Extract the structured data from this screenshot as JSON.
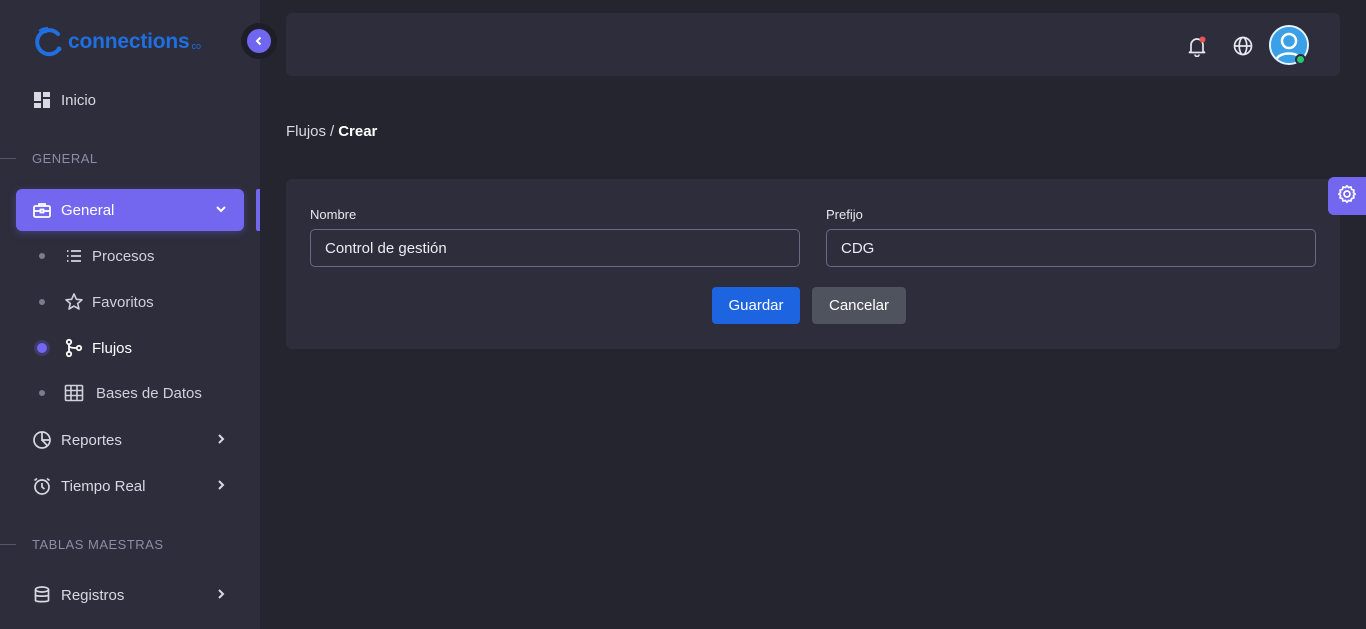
{
  "brand": {
    "name": "connections",
    "suffix": "co",
    "color": "#1f6fe0"
  },
  "sidebar": {
    "home": {
      "label": "Inicio",
      "icon": "dashboard-icon"
    },
    "section_general": "GENERAL",
    "general": {
      "label": "General",
      "icon": "briefcase-icon",
      "expanded": true
    },
    "sub_items": [
      {
        "label": "Procesos",
        "icon": "list-icon",
        "active": false
      },
      {
        "label": "Favoritos",
        "icon": "star-icon",
        "active": false
      },
      {
        "label": "Flujos",
        "icon": "flow-branch-icon",
        "active": true
      },
      {
        "label": "Bases de Datos",
        "icon": "table-grid-icon",
        "active": false
      }
    ],
    "reportes": {
      "label": "Reportes",
      "icon": "pie-chart-icon"
    },
    "tiempo_real": {
      "label": "Tiempo Real",
      "icon": "alarm-clock-icon"
    },
    "section_tablas": "TABLAS MAESTRAS",
    "registros": {
      "label": "Registros",
      "icon": "database-icon"
    }
  },
  "topbar": {
    "notifications_icon": "bell-icon",
    "language_icon": "globe-icon",
    "avatar_icon": "user-avatar-icon",
    "status": "online"
  },
  "breadcrumb": {
    "parent": "Flujos",
    "separator": "/",
    "current": "Crear"
  },
  "form": {
    "nombre_label": "Nombre",
    "nombre_value": "Control de gestión",
    "prefijo_label": "Prefijo",
    "prefijo_value": "CDG",
    "save_label": "Guardar",
    "cancel_label": "Cancelar"
  },
  "colors": {
    "accent": "#7367f0",
    "primary_button": "#1d64e0",
    "secondary_button": "#4f535d",
    "background": "#25252f",
    "panel": "#2d2d3b",
    "status_online": "#28c76f",
    "notification_dot": "#ea5455"
  }
}
